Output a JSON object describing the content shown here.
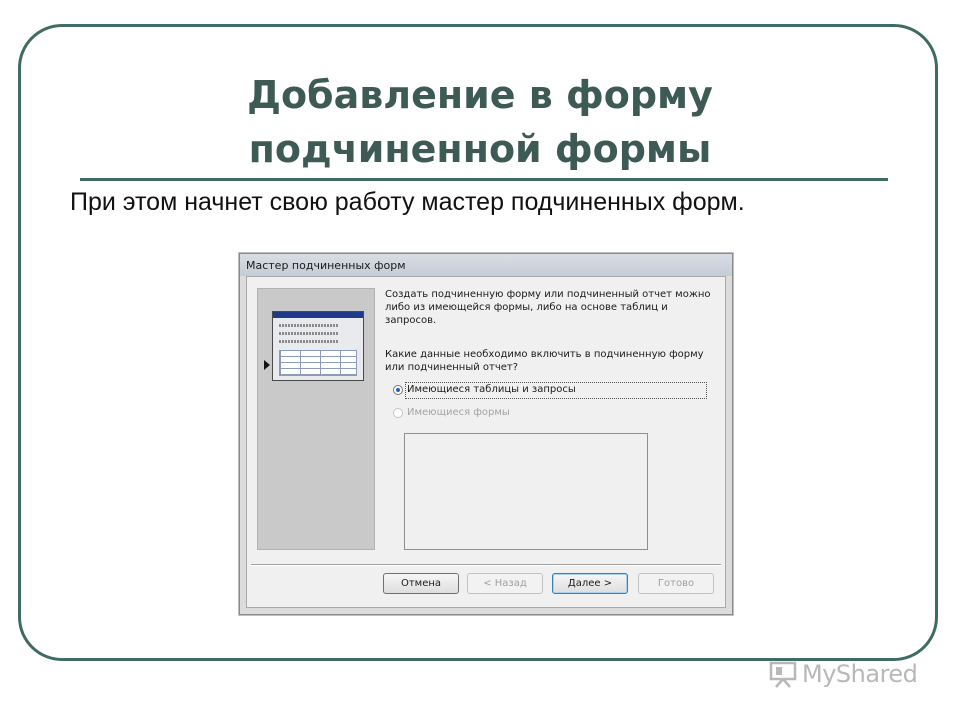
{
  "slide": {
    "title_line1": "Добавление в форму",
    "title_line2": "подчиненной формы",
    "body_text": "При этом начнет свою работу мастер подчиненных форм."
  },
  "dialog": {
    "title": "Мастер подчиненных форм",
    "description": "Создать подчиненную форму или подчиненный отчет можно либо из имеющейся формы, либо на основе таблиц и запросов.",
    "question": "Какие данные необходимо включить в подчиненную форму или подчиненный отчет?",
    "options": [
      {
        "label": "Имеющиеся таблицы и запросы",
        "selected": true,
        "enabled": true
      },
      {
        "label": "Имеющиеся формы",
        "selected": false,
        "enabled": false
      }
    ],
    "buttons": {
      "cancel": "Отмена",
      "back": "< Назад",
      "next": "Далее >",
      "finish": "Готово"
    }
  },
  "watermark": {
    "text": "MyShared",
    "icon": "presentation-board-icon"
  },
  "colors": {
    "frame": "#3f6b63",
    "title": "#3e5a55",
    "selected_radio": "#2b5fb8"
  }
}
